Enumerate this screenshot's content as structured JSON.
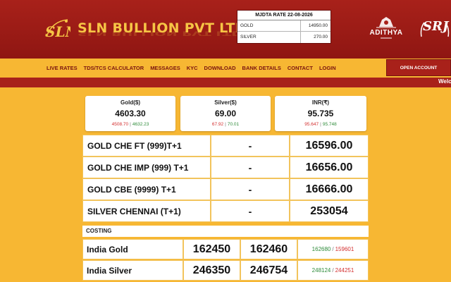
{
  "brand": {
    "name": "SLN BULLION PVT LTD",
    "mark": "SLN"
  },
  "mjdta": {
    "title": "MJDTA RATE 22-08-2026",
    "rows": [
      {
        "label": "GOLD",
        "value": "14950.00"
      },
      {
        "label": "SILVER",
        "value": "270.00"
      }
    ]
  },
  "partners": {
    "adithya": "ADITHYA",
    "srj": "SRJ"
  },
  "nav": {
    "items": [
      "LIVE RATES",
      "TDS/TCS CALCULATOR",
      "MESSAGES",
      "KYC",
      "DOWNLOAD",
      "BANK DETAILS",
      "CONTACT",
      "LOGIN"
    ],
    "open_account": "OPEN ACCOUNT"
  },
  "ticker": {
    "text": "Welc"
  },
  "spot": [
    {
      "title": "Gold($)",
      "value": "4603.30",
      "low": "4508.70",
      "high": "4632.23"
    },
    {
      "title": "Silver($)",
      "value": "69.00",
      "low": "67.92",
      "high": "70.01"
    },
    {
      "title": "INR(₹)",
      "value": "95.735",
      "low": "95.647",
      "high": "95.748"
    }
  ],
  "separator": "|",
  "products": [
    {
      "name": "GOLD CHE FT (999)T+1",
      "mid": "-",
      "price": "16596.00"
    },
    {
      "name": "GOLD CHE IMP (999) T+1",
      "mid": "-",
      "price": "16656.00"
    },
    {
      "name": "GOLD CBE (9999) T+1",
      "mid": "-",
      "price": "16666.00"
    },
    {
      "name": "SILVER CHENNAI (T+1)",
      "mid": "-",
      "price": "253054"
    }
  ],
  "costing": {
    "title": "COSTING",
    "slash": "/",
    "rows": [
      {
        "name": "India Gold",
        "bid": "162450",
        "ask": "162460",
        "high": "162680",
        "low": "159601"
      },
      {
        "name": "India Silver",
        "bid": "246350",
        "ask": "246754",
        "high": "248124",
        "low": "244251"
      }
    ]
  },
  "colors": {
    "header_bg": "#a8211a",
    "page_bg": "#f7b733",
    "brand_gold": "#f6c545",
    "nav_text": "#7a1410",
    "low": "#d32f2f",
    "high": "#2e8b3a"
  }
}
